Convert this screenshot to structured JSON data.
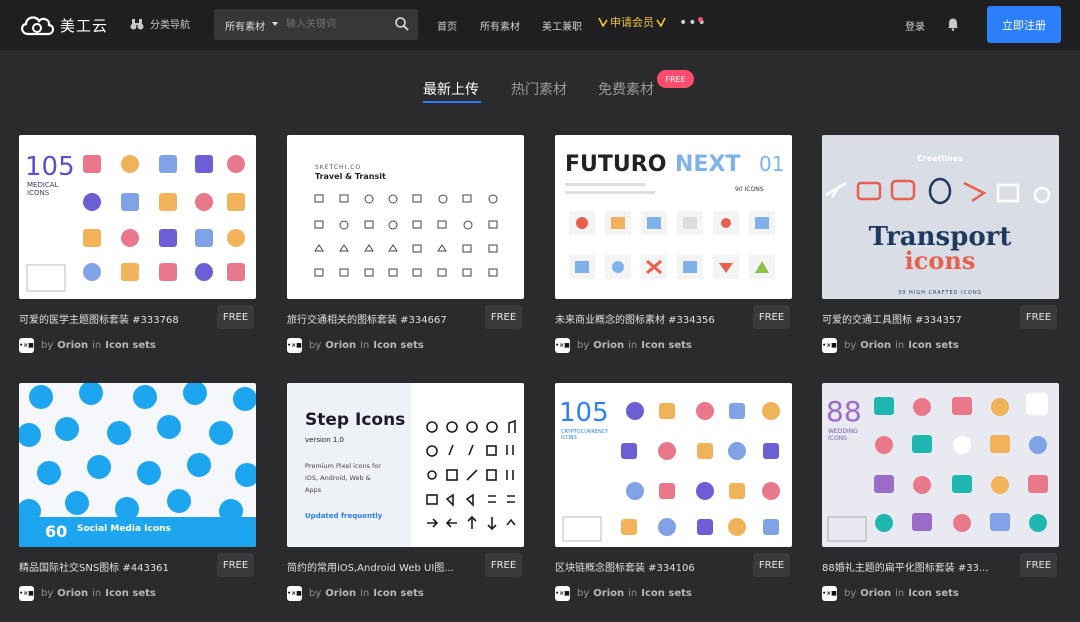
{
  "header": {
    "logo_text": "美工云",
    "category_nav": "分类导航",
    "search": {
      "select": "所有素材",
      "placeholder": "输入关键词"
    },
    "nav": [
      "首页",
      "所有素材",
      "美工兼职"
    ],
    "vip": "申请会员",
    "more": "•••",
    "login": "登录",
    "register": "立即注册"
  },
  "tabs": [
    {
      "label": "最新上传",
      "active": true
    },
    {
      "label": "热门素材",
      "active": false
    },
    {
      "label": "免费素材",
      "active": false
    }
  ],
  "free_badge": "FREE",
  "cards": [
    {
      "title": "可爱的医学主题图标套装 #333768",
      "tag": "FREE",
      "thumb_text": [
        "105",
        "MEDICAL",
        "ICONS"
      ]
    },
    {
      "title": "旅行交通相关的图标套装 #334667",
      "tag": "FREE",
      "thumb_text": [
        "SKETCHI.CO",
        "Travel & Transit"
      ]
    },
    {
      "title": "未来商业概念的图标素材 #334356",
      "tag": "FREE",
      "thumb_text": [
        "FUTURO",
        "NEXT",
        "01",
        "90 ICONS"
      ]
    },
    {
      "title": "可爱的交通工具图标 #334357",
      "tag": "FREE",
      "thumb_text": [
        "Creatlines",
        "Transport",
        "icons",
        "30 HIGH CRAFTED ICONS"
      ]
    },
    {
      "title": "精品国际社交SNS图标 #443361",
      "tag": "FREE",
      "thumb_text": [
        "60",
        "Social Media Icons"
      ]
    },
    {
      "title": "简约的常用iOS,Android Web UI图...",
      "tag": "FREE",
      "thumb_text": [
        "Step Icons",
        "version 1.0",
        "Premium Pixel icons for",
        "iOS, Android, Web &",
        "Apps",
        "Updated frequently"
      ]
    },
    {
      "title": "区块链概念图标套装 #334106",
      "tag": "FREE",
      "thumb_text": [
        "105",
        "CRYPTOCURRENCY",
        "ICONS"
      ]
    },
    {
      "title": "88婚礼主题的扁平化图标套装 #33...",
      "tag": "FREE",
      "thumb_text": [
        "88",
        "WEDDING",
        "ICONS"
      ]
    }
  ],
  "author": {
    "by": "by",
    "name": "Orion",
    "in": "in",
    "category": "Icon sets",
    "avatar": "•×■"
  },
  "colors": {
    "accent": "#2d7ff9",
    "badge": "#ff4d6d",
    "vip": "#f4c136",
    "background": "#2b2b2d",
    "header": "#1f1f21"
  }
}
